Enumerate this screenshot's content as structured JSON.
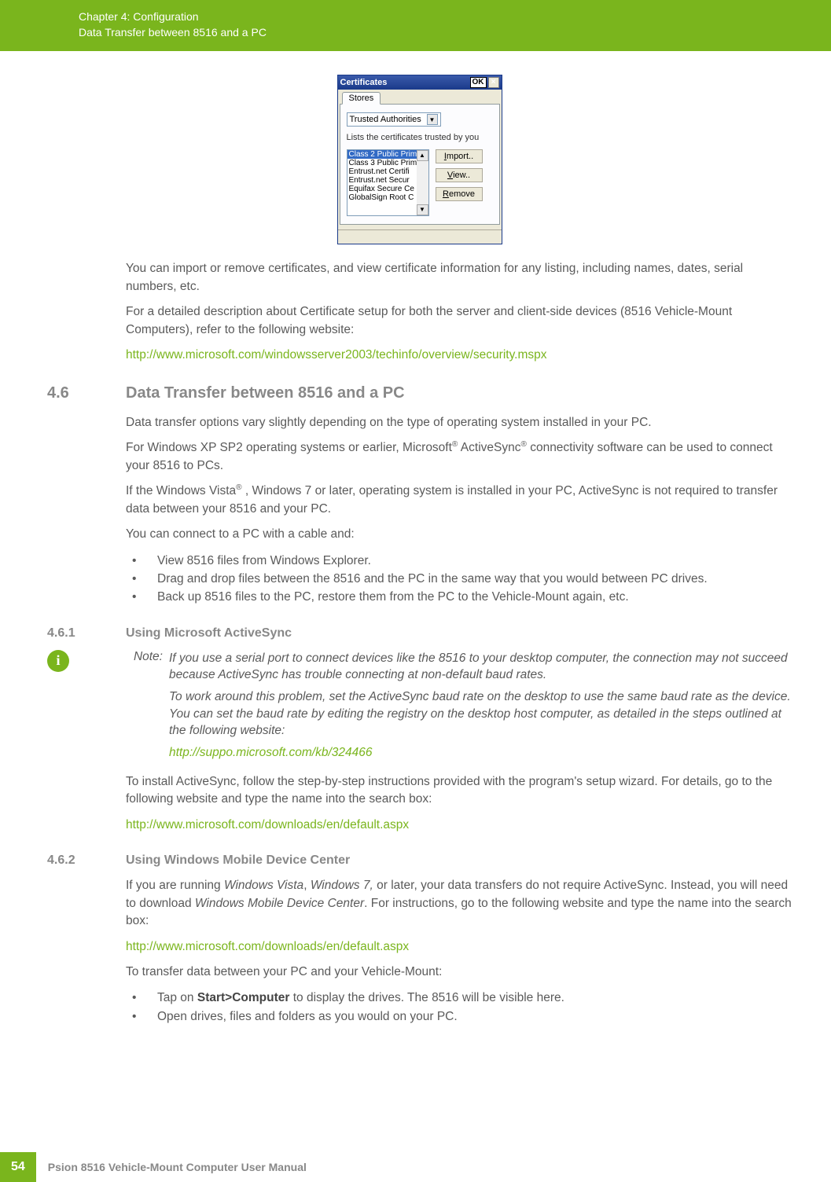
{
  "header": {
    "line1": "Chapter 4:  Configuration",
    "line2": "Data Transfer between 8516 and a PC"
  },
  "cert_window": {
    "title": "Certificates",
    "ok": "OK",
    "close": "×",
    "tab": "Stores",
    "dropdown_value": "Trusted Authorities",
    "description": "Lists the certificates trusted by you",
    "items": [
      "Class 2 Public Prim",
      "Class 3 Public Prim",
      "Entrust.net Certifi",
      "Entrust.net Secur",
      "Equifax Secure Ce",
      "GlobalSign Root C"
    ],
    "buttons": {
      "import_u": "I",
      "import_rest": "mport..",
      "view_u": "V",
      "view_rest": "iew..",
      "remove_u": "R",
      "remove_rest": "emove"
    }
  },
  "body": {
    "p1": "You can import or remove certificates, and view certificate information for any listing, including names, dates, serial numbers, etc.",
    "p2": "For a detailed description about Certificate setup for both the server and client-side devices (8516 Vehicle-Mount Computers), refer to the following website:",
    "p3_link": "http://www.microsoft.com/windowsserver2003/techinfo/overview/security.mspx"
  },
  "section46": {
    "num": "4.6",
    "title": "Data Transfer between 8516 and a PC",
    "p1": "Data transfer options vary slightly depending on the type of operating system installed in your PC.",
    "p2a": "For Windows XP SP2 operating systems or earlier, Microsoft",
    "p2b": " ActiveSync",
    "p2c": " connectivity software can be used to connect your 8516 to PCs.",
    "p3a": "If the Windows Vista",
    "p3b": " , Windows 7 or later, operating system is installed in your PC, ActiveSync is not required to transfer data between your 8516 and your PC.",
    "p4": "You can connect to a PC with a cable and:",
    "bullets": [
      "View 8516 files from Windows Explorer.",
      "Drag and drop files between the 8516 and the PC in the same way that you would between PC drives.",
      "Back up 8516 files to the PC, restore them from the PC to the Vehicle-Mount again, etc."
    ]
  },
  "section461": {
    "num": "4.6.1",
    "title": "Using Microsoft ActiveSync",
    "note_label": "Note:",
    "note_p1": "If you use a serial port to connect devices like the 8516 to your desktop computer, the connection may not succeed because ActiveSync has trouble connecting at non-default baud rates.",
    "note_p2": "To work around this problem, set the ActiveSync baud rate on the desktop to use the same baud rate as the device. You can set the baud rate by editing the registry on the desktop host computer, as detailed in the steps outlined at the following website:",
    "note_link": "http://suppo.microsoft.com/kb/324466",
    "p1": "To install ActiveSync, follow the step-by-step instructions provided with the program's setup wizard. For details, go to the following website and type the name into the search box:",
    "link1": "http://www.microsoft.com/downloads/en/default.aspx"
  },
  "section462": {
    "num": "4.6.2",
    "title": "Using Windows Mobile Device Center",
    "p1a": "If you are running ",
    "p1_em1": "Windows Vista",
    "p1b": ", ",
    "p1_em2": "Windows 7,",
    "p1c": " or later, your data transfers do not require ActiveSync. Instead, you will need to download ",
    "p1_em3": "Windows Mobile Device Center",
    "p1d": ". For instructions, go to the following website and type the name into the search box:",
    "link1": "http://www.microsoft.com/downloads/en/default.aspx",
    "p2": "To transfer data between your PC and your Vehicle-Mount:",
    "b1a": "Tap on ",
    "b1_strong": "Start>Computer",
    "b1b": " to display the drives. The 8516 will be visible here.",
    "b2": "Open drives, files and folders as you would on your PC."
  },
  "footer": {
    "page": "54",
    "text": "Psion 8516 Vehicle-Mount Computer User Manual"
  }
}
